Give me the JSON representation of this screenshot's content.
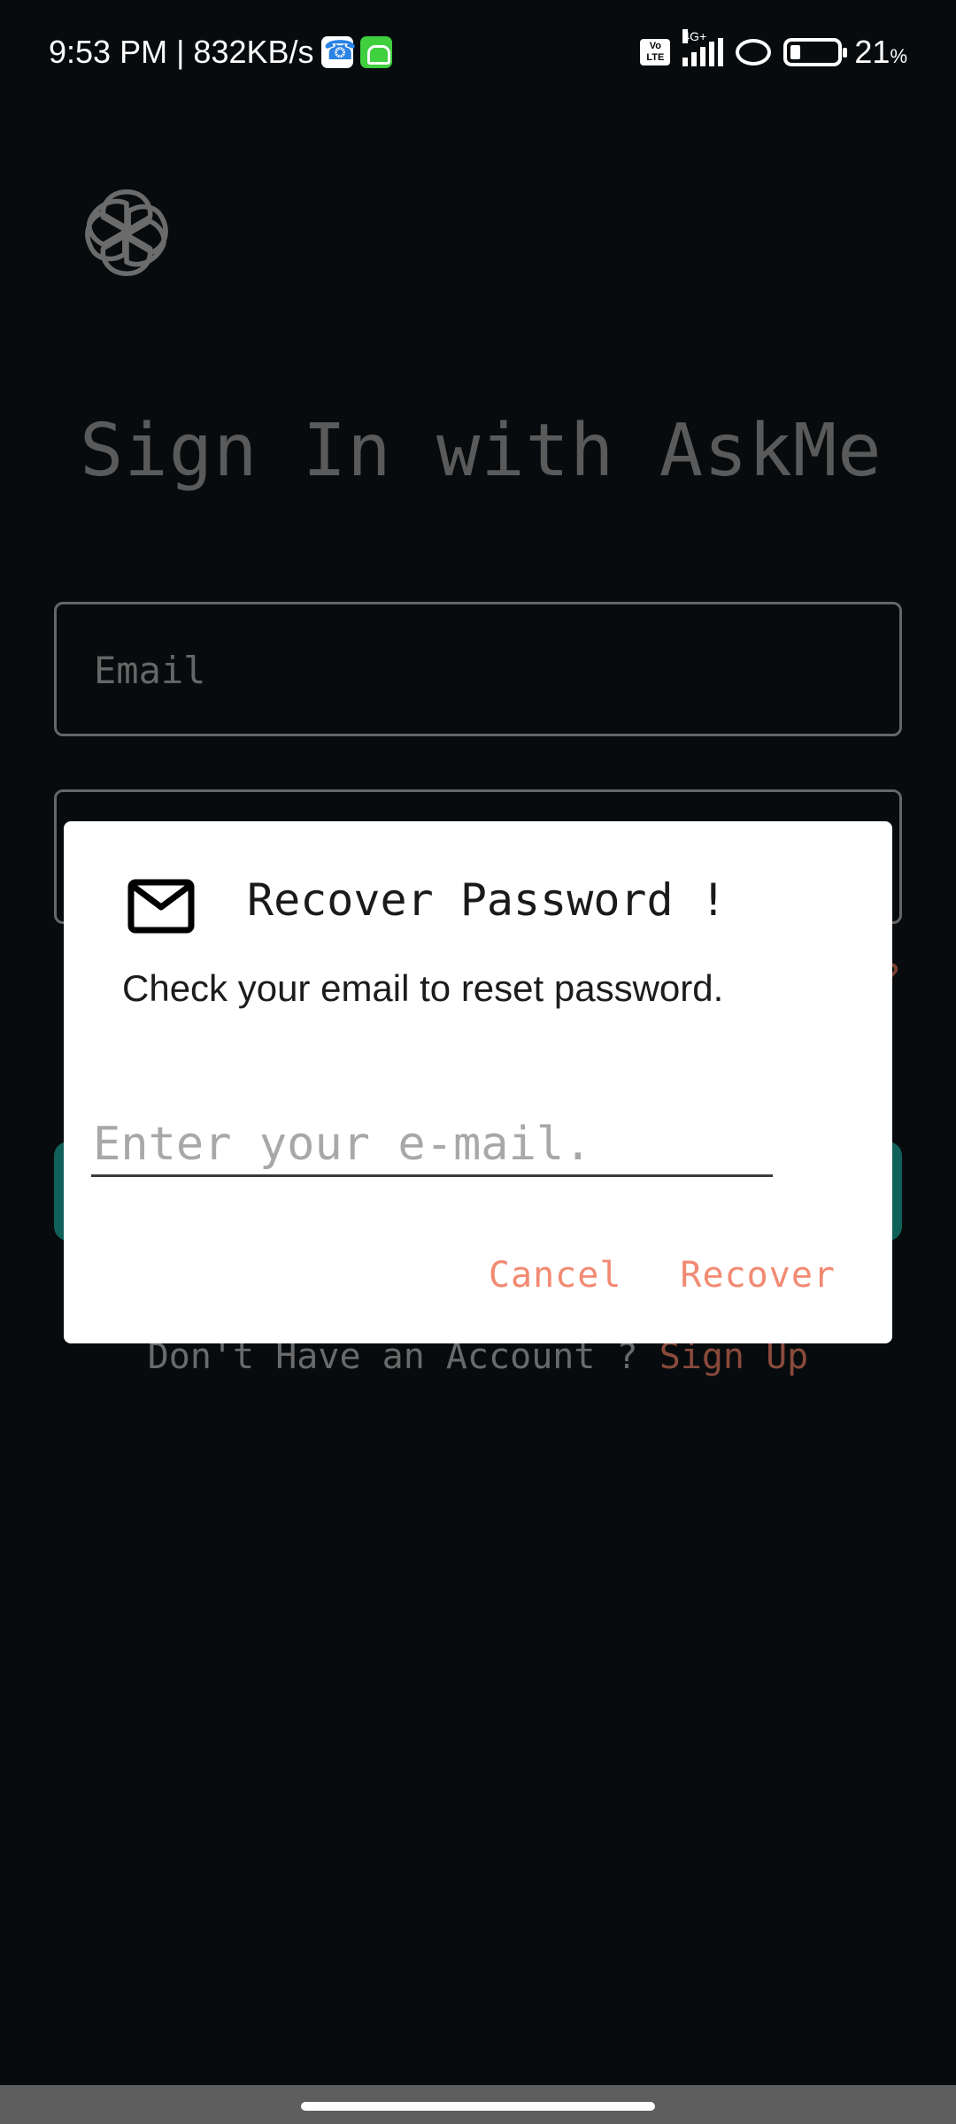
{
  "status_bar": {
    "time_speed": "9:53 PM | 832KB/s",
    "volte_label": "Vo LTE",
    "network_type": "4G+",
    "battery_percent": "21",
    "battery_unit": "%",
    "battery_level": 0.21
  },
  "page": {
    "title": "Sign In with AskMe",
    "email_placeholder": "Email",
    "signup_prompt": "Don't Have an Account ? ",
    "signup_link": "Sign Up"
  },
  "dialog": {
    "icon": "mail-icon",
    "title": "Recover Password !",
    "message": "Check your email to reset password.",
    "input_placeholder": "Enter your e-mail.",
    "input_value": "",
    "cancel_label": "Cancel",
    "recover_label": "Recover"
  },
  "colors": {
    "background": "#070b0d",
    "accent": "#f28a72",
    "button_teal": "#10605a"
  }
}
